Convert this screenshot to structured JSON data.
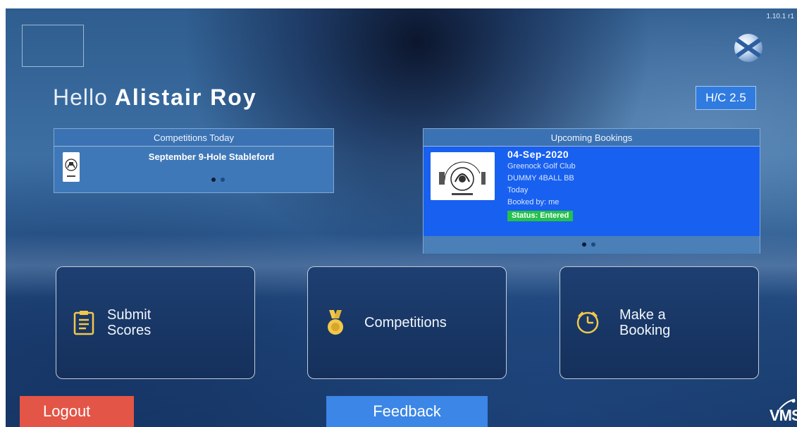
{
  "app": {
    "version": "1.10.1 r1"
  },
  "greeting": {
    "prefix": "Hello",
    "name": "Alistair Roy"
  },
  "handicap": {
    "label": "H/C 2.5"
  },
  "competitions_today": {
    "header": "Competitions Today",
    "items": [
      {
        "title": "September 9-Hole Stableford"
      }
    ],
    "page_count": 2,
    "active_page": 1
  },
  "upcoming_bookings": {
    "header": "Upcoming Bookings",
    "items": [
      {
        "date": "04-Sep-2020",
        "club": "Greenock Golf Club",
        "event": "DUMMY 4BALL BB",
        "when": "Today",
        "booked_by": "Booked by: me",
        "status": "Status: Entered"
      }
    ],
    "page_count": 2,
    "active_page": 1
  },
  "club_logo": {
    "lettering": "GREENOCK GOLF CLUB 1890"
  },
  "tiles": [
    {
      "label_line1": "Submit",
      "label_line2": "Scores",
      "icon": "clipboard-icon"
    },
    {
      "label_line1": "Competitions",
      "label_line2": "",
      "icon": "medal-icon"
    },
    {
      "label_line1": "Make a",
      "label_line2": "Booking",
      "icon": "clock-icon"
    }
  ],
  "buttons": {
    "logout": "Logout",
    "feedback": "Feedback"
  },
  "brand": {
    "footer_logo": "VMS"
  },
  "colors": {
    "accent_blue": "#1860f0",
    "handicap_blue": "#2f7be0",
    "logout_red": "#e35546",
    "feedback_blue": "#3b86e6",
    "status_green": "#25c04d",
    "icon_gold": "#f2c84b"
  }
}
